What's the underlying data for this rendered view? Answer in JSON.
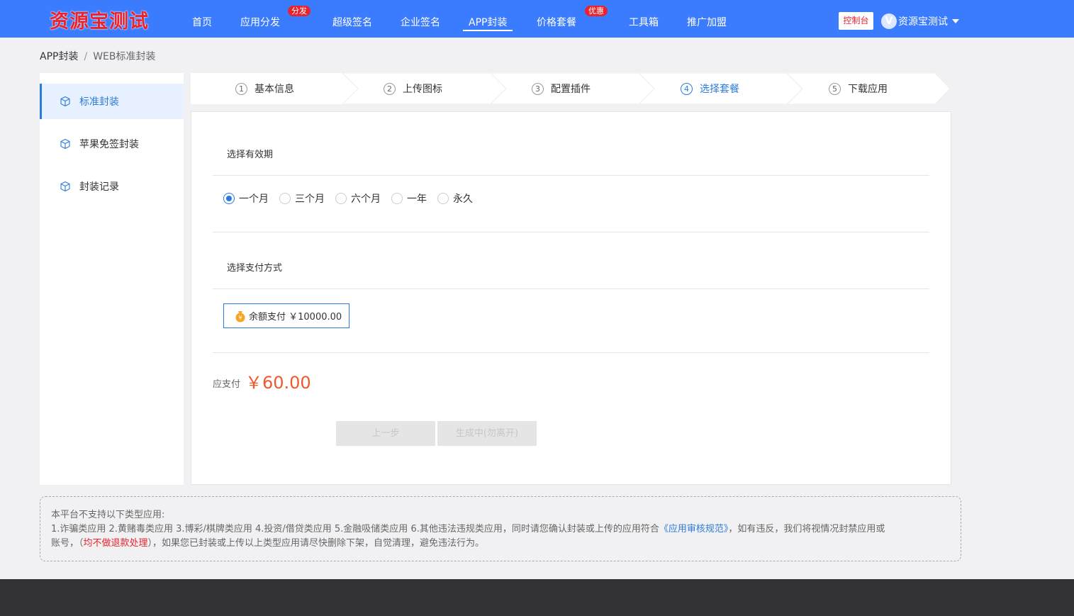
{
  "header": {
    "logo": "资源宝测试",
    "nav": [
      {
        "label": "首页",
        "badge": ""
      },
      {
        "label": "应用分发",
        "badge": "分发"
      },
      {
        "label": "超级签名",
        "badge": ""
      },
      {
        "label": "企业签名",
        "badge": ""
      },
      {
        "label": "APP封装",
        "badge": "",
        "active": true
      },
      {
        "label": "价格套餐",
        "badge": "优惠"
      },
      {
        "label": "工具箱",
        "badge": ""
      },
      {
        "label": "推广加盟",
        "badge": ""
      }
    ],
    "console": "控制台",
    "avatar_letter": "V",
    "username": "资源宝测试"
  },
  "breadcrumb": {
    "root": "APP封装",
    "separator": "/",
    "current": "WEB标准封装"
  },
  "sidebar": {
    "items": [
      {
        "label": "标准封装",
        "icon": "cube-icon",
        "active": true
      },
      {
        "label": "苹果免签封装",
        "icon": "cube-icon"
      },
      {
        "label": "封装记录",
        "icon": "cube-icon"
      }
    ]
  },
  "steps": [
    {
      "num": "1",
      "label": "基本信息"
    },
    {
      "num": "2",
      "label": "上传图标"
    },
    {
      "num": "3",
      "label": "配置插件"
    },
    {
      "num": "4",
      "label": "选择套餐",
      "active": true
    },
    {
      "num": "5",
      "label": "下载应用"
    }
  ],
  "validity": {
    "title": "选择有效期",
    "options": [
      "一个月",
      "三个月",
      "六个月",
      "一年",
      "永久"
    ],
    "selected": "一个月"
  },
  "payment": {
    "title": "选择支付方式",
    "method": "余额支付 ￥10000.00",
    "icon": "money-bag-icon"
  },
  "total": {
    "label": "应支付",
    "value": "￥60.00"
  },
  "buttons": {
    "prev": "上一步",
    "generate": "生成中(勿离开)"
  },
  "notice": {
    "line1": "本平台不支持以下类型应用:",
    "line2_a": "1.诈骗类应用 2.黄赌毒类应用 3.博彩/棋牌类应用 4.投资/借贷类应用 5.金融吸储类应用 6.其他违法违规类应用，同时请您确认封装或上传的应用符合",
    "line2_link": "《应用审核规范》",
    "line2_b": "，如有违反，我们将视情况封禁应用或",
    "line3_a": "账号，（",
    "line3_red": "均不做退款处理",
    "line3_b": "），如果您已封装或上传以上类型应用请尽快删除下架，自觉清理，避免违法行为。"
  },
  "colors": {
    "primary": "#3b7cff",
    "accent_blue": "#2d7bd8",
    "price": "#f0582c",
    "danger": "#e8232d"
  }
}
